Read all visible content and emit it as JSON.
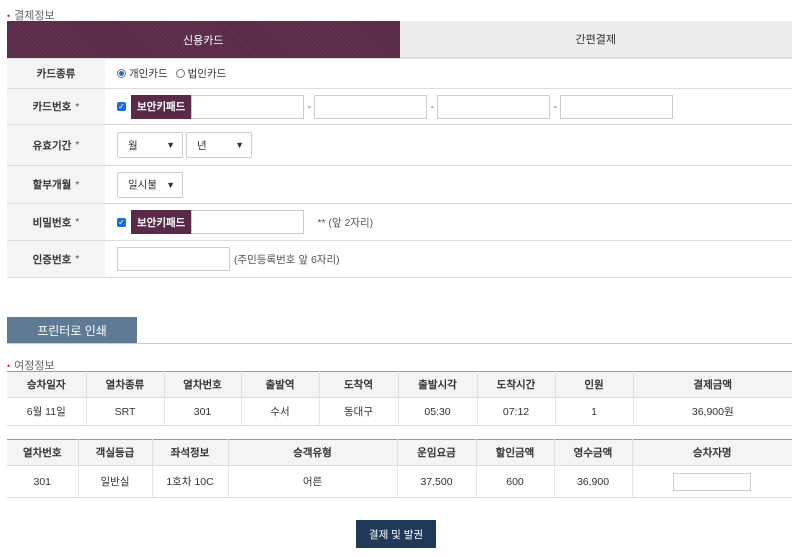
{
  "payment_section": {
    "title": "결제정보"
  },
  "tabs": [
    {
      "label": "신용카드"
    },
    {
      "label": "간편결제"
    }
  ],
  "form": {
    "card_type": {
      "label": "카드종류",
      "options": [
        "개인카드",
        "법인카드"
      ],
      "selected": "개인카드"
    },
    "card_number": {
      "label": "카드번호",
      "required_mark": "*",
      "keypad_label": "보안키패드",
      "separator": "-"
    },
    "expiry": {
      "label": "유효기간",
      "required_mark": "*",
      "month_value": "월",
      "year_value": "년"
    },
    "installment": {
      "label": "할부개월",
      "required_mark": "*",
      "value": "일시불"
    },
    "password": {
      "label": "비밀번호",
      "required_mark": "*",
      "keypad_label": "보안키패드",
      "hint": "** (앞 2자리)"
    },
    "auth_number": {
      "label": "인증번호",
      "required_mark": "*",
      "hint": "(주민등록번호 앞 6자리)"
    }
  },
  "print_button": {
    "label": "프린터로 인쇄"
  },
  "journey_section": {
    "title": "여정정보"
  },
  "journey_table": {
    "headers": [
      "승차일자",
      "열차종류",
      "열차번호",
      "출발역",
      "도착역",
      "출발시각",
      "도착시간",
      "인원",
      "결제금액"
    ],
    "rows": [
      [
        "6월 11일",
        "SRT",
        "301",
        "수서",
        "동대구",
        "05:30",
        "07:12",
        "1",
        "36,900원"
      ]
    ]
  },
  "seat_table": {
    "headers": [
      "열차번호",
      "객실등급",
      "좌석정보",
      "승객유형",
      "운임요금",
      "할인금액",
      "영수금액",
      "승차자명"
    ],
    "rows": [
      [
        "301",
        "일반실",
        "1호차 10C",
        "어른",
        "37,500",
        "600",
        "36,900",
        ""
      ]
    ]
  },
  "pay_button": {
    "label": "결제 및 발권"
  },
  "colors": {
    "accent": "#5a2a49",
    "print_button": "#5e7a94",
    "pay_button": "#1e3a58"
  }
}
